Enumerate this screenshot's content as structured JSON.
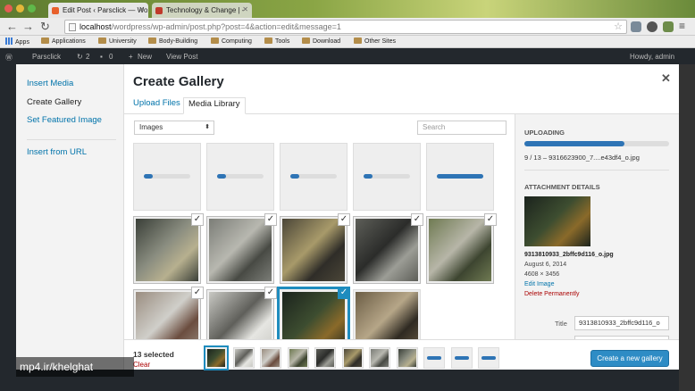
{
  "browser": {
    "tabs": [
      {
        "label": "Edit Post ‹ Parsclick — Wo",
        "active": true
      },
      {
        "label": "Technology & Change | -",
        "active": false
      }
    ],
    "address": {
      "host": "localhost",
      "path": "/wordpress/wp-admin/post.php?post=4&action=edit&message=1"
    },
    "bookmarks": [
      "Apps",
      "Applications",
      "University",
      "Body-Building",
      "Computing",
      "Tools",
      "Download",
      "Other Sites"
    ]
  },
  "wp_admin_bar": {
    "site": "Parsclick",
    "updates": "2",
    "comments": "0",
    "new": "New",
    "view_post": "View Post",
    "howdy": "Howdy, admin"
  },
  "modal": {
    "sidebar": {
      "items": [
        {
          "label": "Insert Media",
          "active": false
        },
        {
          "label": "Create Gallery",
          "active": true
        },
        {
          "label": "Set Featured Image",
          "active": false
        }
      ],
      "insert_from_url": "Insert from URL"
    },
    "title": "Create Gallery",
    "close_icon": "close-icon",
    "tabs": [
      {
        "label": "Upload Files",
        "active": false
      },
      {
        "label": "Media Library",
        "active": true
      }
    ],
    "filter": {
      "selected": "Images"
    },
    "search": {
      "placeholder": "Search"
    },
    "uploading_items": [
      {
        "progress": 0.2
      },
      {
        "progress": 0.2
      },
      {
        "progress": 0.2
      },
      {
        "progress": 0.2
      },
      {
        "progress": 1.0
      }
    ],
    "image_items": [
      {
        "selected": true,
        "focused": false,
        "palette": [
          "#3a3f38",
          "#8a8d80",
          "#b7b08f"
        ]
      },
      {
        "selected": true,
        "focused": false,
        "palette": [
          "#7b7d77",
          "#b8b8b0",
          "#484a44"
        ]
      },
      {
        "selected": true,
        "focused": false,
        "palette": [
          "#4b4638",
          "#a89a6a",
          "#2f2d28"
        ]
      },
      {
        "selected": true,
        "focused": false,
        "palette": [
          "#5d5e58",
          "#2b2c2a",
          "#9c9d96"
        ]
      },
      {
        "selected": true,
        "focused": false,
        "palette": [
          "#6f7a52",
          "#b7b6a8",
          "#3d4530"
        ]
      },
      {
        "selected": true,
        "focused": false,
        "palette": [
          "#9a8d80",
          "#d0cfca",
          "#6b4d3f"
        ]
      },
      {
        "selected": true,
        "focused": false,
        "palette": [
          "#c9c9c4",
          "#5f5f5a",
          "#e6e6e2"
        ]
      },
      {
        "selected": true,
        "focused": true,
        "palette": [
          "#1b231d",
          "#3d4d30",
          "#8a6a2a"
        ]
      },
      {
        "selected": false,
        "focused": false,
        "palette": [
          "#6b5d45",
          "#b6a688",
          "#2f2a22"
        ]
      }
    ],
    "details": {
      "uploading_heading": "UPLOADING",
      "upload_progress": 0.69,
      "upload_status": "9 / 13  –  9316623900_7....e43df4_o.jpg",
      "attachment_heading": "ATTACHMENT DETAILS",
      "thumb_palette": [
        "#1b231d",
        "#3d4d30",
        "#8a6a2a"
      ],
      "filename": "9313810933_2bffc9d116_o.jpg",
      "date": "August 6, 2014",
      "dimensions": "4608 × 3456",
      "edit_image": "Edit Image",
      "delete": "Delete Permanently",
      "title_label": "Title",
      "title_value": "9313810933_2bffc9d116_o"
    },
    "footer": {
      "selected_count": "13 selected",
      "clear": "Clear",
      "mini_thumbs": [
        {
          "kind": "image",
          "focused": true,
          "palette": [
            "#1b231d",
            "#3d4d30",
            "#8a6a2a"
          ]
        },
        {
          "kind": "image",
          "focused": false,
          "palette": [
            "#c9c9c4",
            "#5f5f5a",
            "#e6e6e2"
          ]
        },
        {
          "kind": "image",
          "focused": false,
          "palette": [
            "#9a8d80",
            "#d0cfca",
            "#6b4d3f"
          ]
        },
        {
          "kind": "image",
          "focused": false,
          "palette": [
            "#6f7a52",
            "#b7b6a8",
            "#3d4530"
          ]
        },
        {
          "kind": "image",
          "focused": false,
          "palette": [
            "#5d5e58",
            "#2b2c2a",
            "#9c9d96"
          ]
        },
        {
          "kind": "image",
          "focused": false,
          "palette": [
            "#4b4638",
            "#a89a6a",
            "#2f2d28"
          ]
        },
        {
          "kind": "image",
          "focused": false,
          "palette": [
            "#7b7d77",
            "#b8b8b0",
            "#484a44"
          ]
        },
        {
          "kind": "image",
          "focused": false,
          "palette": [
            "#3a3f38",
            "#8a8d80",
            "#b7b08f"
          ]
        },
        {
          "kind": "uploading",
          "focused": false
        },
        {
          "kind": "uploading",
          "focused": false
        },
        {
          "kind": "uploading",
          "focused": false
        }
      ],
      "create_button": "Create a new gallery"
    }
  },
  "watermark": "mp4.ir/khelghat"
}
